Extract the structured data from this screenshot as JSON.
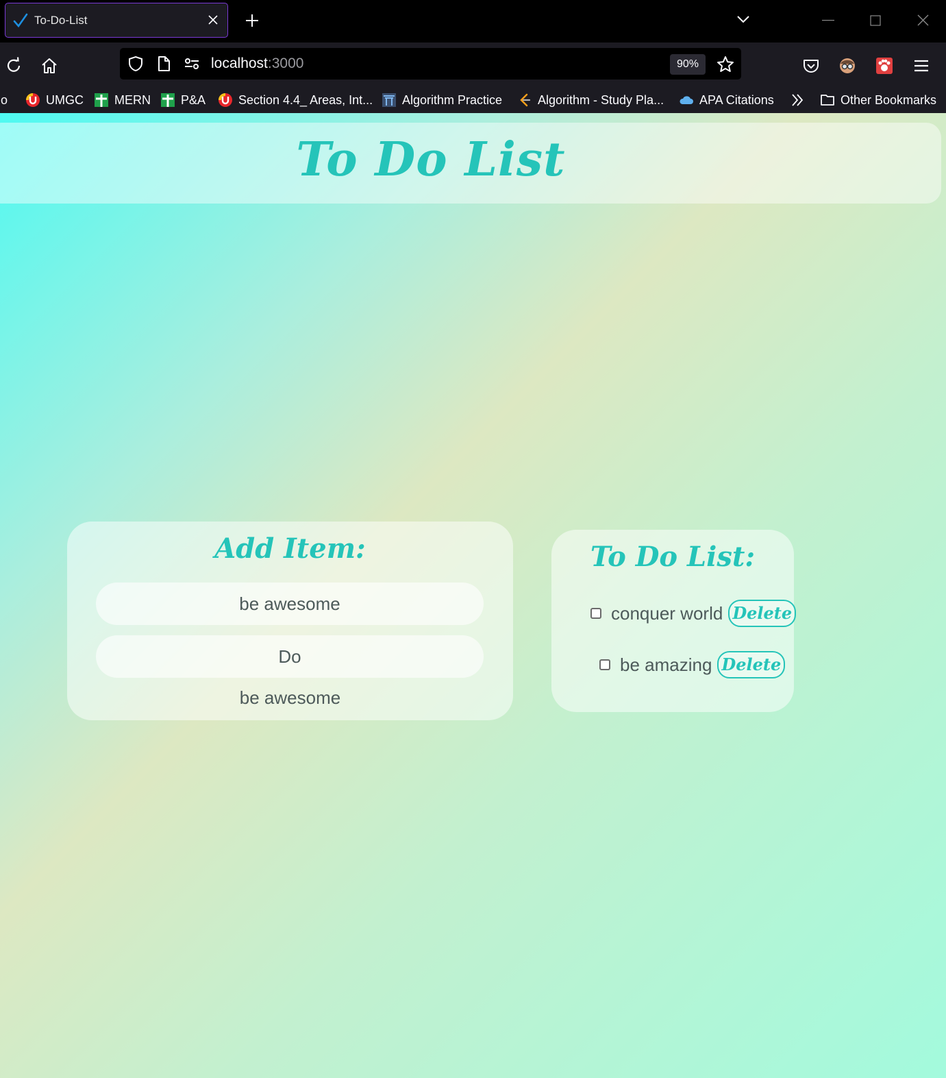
{
  "browser": {
    "tab": {
      "title": "To-Do-List"
    },
    "url": {
      "host": "localhost",
      "port": ":3000"
    },
    "zoom": "90%",
    "bookmarks": [
      {
        "label": "jo",
        "icon": "none"
      },
      {
        "label": "UMGC",
        "icon": "umgc-icon"
      },
      {
        "label": "MERN",
        "icon": "green-plus-icon"
      },
      {
        "label": "P&A",
        "icon": "green-plus-icon"
      },
      {
        "label": "Section 4.4_ Areas, Int...",
        "icon": "umgc-icon"
      },
      {
        "label": "Algorithm Practice",
        "icon": "gate-icon"
      },
      {
        "label": "Algorithm - Study Pla...",
        "icon": "leetcode-icon"
      },
      {
        "label": "APA Citations",
        "icon": "cloud-icon"
      }
    ],
    "other_bookmarks": "Other Bookmarks"
  },
  "page": {
    "title": "To Do List",
    "add_card": {
      "heading": "Add Item:",
      "input_value": "be awesome",
      "button_label": "Do",
      "preview": "be awesome"
    },
    "list_card": {
      "heading": "To Do List:",
      "items": [
        {
          "text": "conquer world",
          "delete_label": "Delete",
          "checked": false
        },
        {
          "text": "be amazing",
          "delete_label": "Delete",
          "checked": false
        }
      ]
    }
  },
  "colors": {
    "accent": "#25c4b9",
    "text": "#4d5a5a",
    "tab_border": "#7a3ad6"
  }
}
